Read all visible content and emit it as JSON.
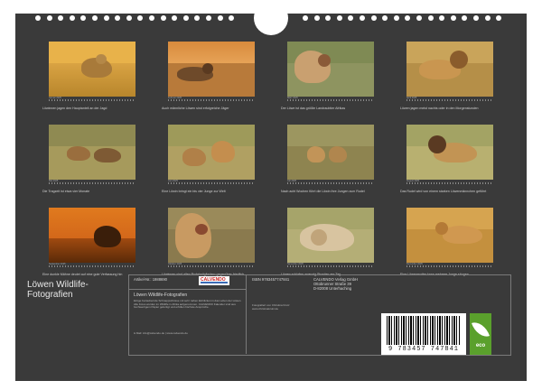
{
  "calendar_title": "Löwen Wildlife-Fotografien",
  "colors": {
    "sheet": "#3a3a3a",
    "text": "#d0d0d0",
    "eco_green": "#5aa02c",
    "calvendo_red": "#c41e1e"
  },
  "months": [
    {
      "month": "Januar 2025",
      "caption": "Löwinnen jagen den Hauptanteil an der Jagd"
    },
    {
      "month": "Februar 2025",
      "caption": "Auch männliche Löwen sind erfolgreiche Jäger"
    },
    {
      "month": "März 2025",
      "caption": "Der Löwe ist das größte Landraubtier Afrikas"
    },
    {
      "month": "April 2025",
      "caption": "Löwen jagen meist nachts oder in den Morgenstunden"
    },
    {
      "month": "Mai 2025",
      "caption": "Die Tragzeit ist etwa vier Monate"
    },
    {
      "month": "Juni 2025",
      "caption": "Eine Löwin bringt ein bis vier Junge zur Welt"
    },
    {
      "month": "Juli 2025",
      "caption": "Nach acht Wochen führt die Löwin ihre Jungen zum Rudel"
    },
    {
      "month": "August 2025",
      "caption": "Das Rudel wird von einem starken Löwenmännchen geführt"
    },
    {
      "month": "September 2025",
      "caption": "Eine dunkle Mähne deutet auf eine gute Verfassung hin"
    },
    {
      "month": "Oktober 2025",
      "caption": "Löwinnen sind allen Rudelmitgliedern gegenüber friedlich"
    },
    {
      "month": "November 2025",
      "caption": "Löwen schlafen zwanzig Stunden am Tag"
    },
    {
      "month": "Dezember 2025",
      "caption": "Eine Löwenmutter kann mehrere Junge säugen"
    }
  ],
  "info": {
    "article_no": "Artikel-Nr.: 1988690",
    "product_title": "Löwen Wildlife-Fotografien",
    "description": "Einige bezaubernde Schnappschüsse mit sehr nahen Einblicken in das Leben der Löwen. Alle Fotos wurden im Wildlife in Afrika aufgenommen. CALVENDO Kalender sind aus hochwertigem Papier gefertigt und erfüllen höchste Ansprüche.",
    "publisher_url": "& Mail: info@calvendo.de | www.calvendo.de",
    "isbn": "ISBN 9783457747841",
    "photographer": "Fotografiert von Christina Krutz",
    "photographer_site": "www.christinakrutz.de",
    "publisher_name": "CALVENDO Verlag GmbH",
    "street": "Ottobrunner Straße 39",
    "city": "D-82008 Unterhaching",
    "logo_text": "CALVENDO",
    "barcode_number": "9 783457 747841",
    "eco_label": "eco"
  }
}
